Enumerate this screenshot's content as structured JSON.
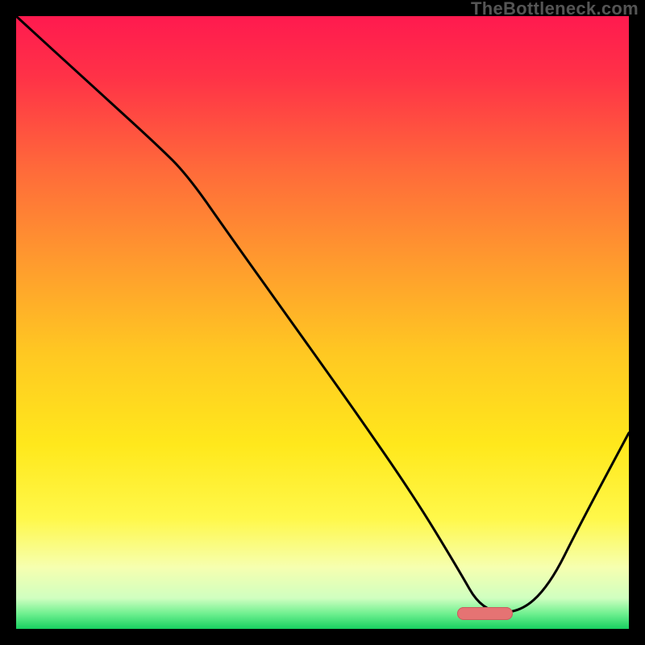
{
  "watermark_text": "TheBottleneck.com",
  "frame": {
    "outer_size": 800,
    "border_px": 20,
    "plot_origin": 20,
    "plot_size": 760,
    "border_color": "#000000"
  },
  "gradient_stops": [
    {
      "offset": 0.0,
      "color": "#ff1a4f"
    },
    {
      "offset": 0.1,
      "color": "#ff3247"
    },
    {
      "offset": 0.25,
      "color": "#ff6a3a"
    },
    {
      "offset": 0.4,
      "color": "#ff9a2e"
    },
    {
      "offset": 0.55,
      "color": "#ffc822"
    },
    {
      "offset": 0.7,
      "color": "#ffe81c"
    },
    {
      "offset": 0.82,
      "color": "#fff84a"
    },
    {
      "offset": 0.9,
      "color": "#f6ffb0"
    },
    {
      "offset": 0.95,
      "color": "#d0ffc0"
    },
    {
      "offset": 0.975,
      "color": "#70f090"
    },
    {
      "offset": 1.0,
      "color": "#18d060"
    }
  ],
  "marker": {
    "color_fill": "#e57373",
    "color_stroke": "#c85f5f",
    "x_frac": 0.765,
    "y_frac": 0.975,
    "w_frac": 0.09,
    "h_frac": 0.022
  },
  "chart_data": {
    "type": "line",
    "title": "",
    "xlabel": "",
    "ylabel": "",
    "xlim": [
      0,
      1
    ],
    "ylim": [
      0,
      1
    ],
    "note": "Axes unlabeled in source image; values are normalized fractions of the plot area (x→right, y→up). Background color encodes y (red=high mismatch, green=low).",
    "series": [
      {
        "name": "bottleneck-curve",
        "x": [
          0.0,
          0.12,
          0.23,
          0.28,
          0.35,
          0.45,
          0.55,
          0.65,
          0.72,
          0.76,
          0.82,
          0.87,
          0.92,
          1.0
        ],
        "y": [
          1.0,
          0.89,
          0.79,
          0.74,
          0.64,
          0.5,
          0.36,
          0.215,
          0.1,
          0.03,
          0.025,
          0.07,
          0.17,
          0.32
        ]
      }
    ],
    "annotations": [
      {
        "name": "optimal-marker",
        "x": 0.79,
        "y": 0.025,
        "label": ""
      }
    ]
  }
}
